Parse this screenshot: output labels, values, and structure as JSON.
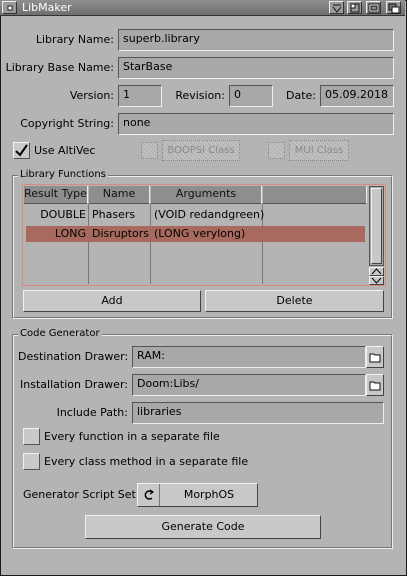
{
  "window": {
    "title": "LibMaker"
  },
  "fields": {
    "library_name_label": "Library Name:",
    "library_name_value": "superb.library",
    "library_base_label": "Library Base Name:",
    "library_base_value": "StarBase",
    "version_label": "Version:",
    "version_value": "1",
    "revision_label": "Revision:",
    "revision_value": "0",
    "date_label": "Date:",
    "date_value": "05.09.2018",
    "copyright_label": "Copyright String:",
    "copyright_value": "none"
  },
  "options": {
    "use_altivec_label": "Use AltiVec",
    "use_altivec_checked": true,
    "boopsi_label": "BOOPSI Class",
    "mui_label": "MUI Class"
  },
  "library_functions": {
    "legend": "Library Functions",
    "columns": [
      "Result Type",
      "Name",
      "Arguments"
    ],
    "rows": [
      {
        "result": "DOUBLE",
        "name": "Phasers",
        "args": "(VOID redandgreen)"
      },
      {
        "result": "LONG",
        "name": "Disruptors",
        "args": "(LONG verylong)"
      }
    ],
    "add_label": "Add",
    "delete_label": "Delete"
  },
  "code_generator": {
    "legend": "Code Generator",
    "destination_label": "Destination Drawer:",
    "destination_value": "RAM:",
    "installation_label": "Installation Drawer:",
    "installation_value": "Doom:Libs/",
    "include_label": "Include Path:",
    "include_value": "libraries",
    "every_function_label": "Every function in a separate file",
    "every_class_label": "Every class method in a separate file",
    "script_set_label": "Generator Script Set:",
    "script_set_value": "MorphOS",
    "generate_label": "Generate Code"
  },
  "colors": {
    "selection": "#a86a5e",
    "list_border": "#d88a7c",
    "background": "#b4b4b4"
  },
  "icons": [
    "close-icon",
    "iconify-icon",
    "depth-icon",
    "zoom-icon",
    "drawer-icon",
    "cycle-icon",
    "checkmark-icon",
    "arrow-up-icon",
    "arrow-down-icon"
  ]
}
